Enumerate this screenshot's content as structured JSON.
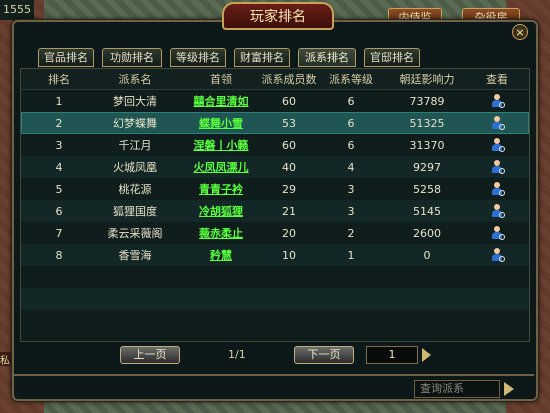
{
  "world": {
    "top_left_counter": "1555",
    "side_label": "私",
    "tabs": [
      "内侍监",
      "杂役房"
    ]
  },
  "window": {
    "title": "玩家排名",
    "close_glyph": "×"
  },
  "tabs": [
    {
      "label": "官品排名",
      "active": false
    },
    {
      "label": "功勋排名",
      "active": false
    },
    {
      "label": "等级排名",
      "active": false
    },
    {
      "label": "财富排名",
      "active": false
    },
    {
      "label": "派系排名",
      "active": true
    },
    {
      "label": "官邸排名",
      "active": false
    }
  ],
  "table": {
    "columns": [
      "排名",
      "派系名",
      "首领",
      "派系成员数",
      "派系等级",
      "朝廷影响力",
      "查看"
    ],
    "rows": [
      {
        "rank": "1",
        "faction": "梦回大清",
        "leader": "囍合里清如",
        "members": "60",
        "level": "6",
        "influence": "73789"
      },
      {
        "rank": "2",
        "faction": "幻梦蝶舞",
        "leader": "蝶舞小雪",
        "members": "53",
        "level": "6",
        "influence": "51325"
      },
      {
        "rank": "3",
        "faction": "千江月",
        "leader": "涅磐丨小籁",
        "members": "60",
        "level": "6",
        "influence": "31370"
      },
      {
        "rank": "4",
        "faction": "火城凤凰",
        "leader": "火凤凤漂儿",
        "members": "40",
        "level": "4",
        "influence": "9297"
      },
      {
        "rank": "5",
        "faction": "桃花源",
        "leader": "青青子衿",
        "members": "29",
        "level": "3",
        "influence": "5258"
      },
      {
        "rank": "6",
        "faction": "狐狸国度",
        "leader": "冷胡狐狸",
        "members": "21",
        "level": "3",
        "influence": "5145"
      },
      {
        "rank": "7",
        "faction": "柔云采薇阁",
        "leader": "薇赤柔止",
        "members": "20",
        "level": "2",
        "influence": "2600"
      },
      {
        "rank": "8",
        "faction": "香雪海",
        "leader": "矜慧",
        "members": "10",
        "level": "1",
        "influence": "0"
      }
    ],
    "selected_row": 2,
    "view_icon": "person-magnifier-icon"
  },
  "pager": {
    "prev_label": "上一页",
    "page_info": "1/1",
    "next_label": "下一页",
    "page_value": "1"
  },
  "search": {
    "placeholder": "查询派系"
  },
  "colors": {
    "leader_link": "#58ff3c",
    "selected_row": "#1f5552",
    "panel_bg": "#0c1918",
    "border_gold": "#c9a45a"
  }
}
